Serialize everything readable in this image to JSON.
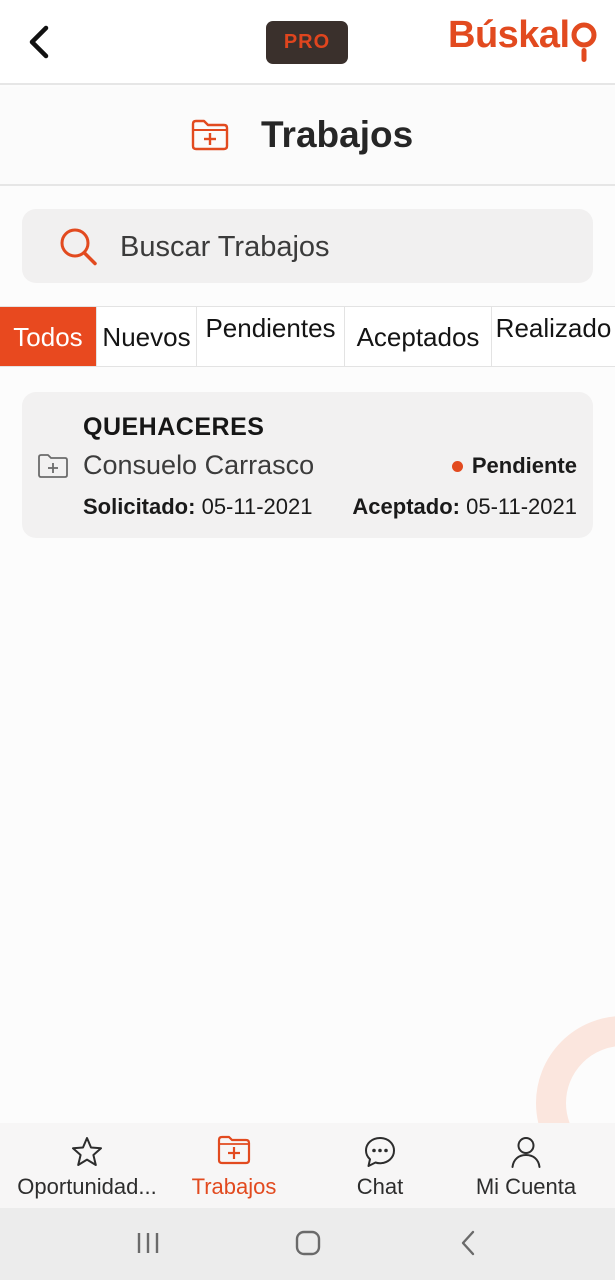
{
  "topbar": {
    "back_icon": "chevron-left-icon",
    "pro_label": "PRO",
    "logo_text": "Búskal",
    "logo_pin_icon": "map-pin-o-icon"
  },
  "header": {
    "icon": "folder-plus-icon",
    "title": "Trabajos"
  },
  "search": {
    "icon": "search-icon",
    "placeholder": "Buscar Trabajos",
    "value": ""
  },
  "tabs": [
    {
      "label": "Todos",
      "active": true
    },
    {
      "label": "Nuevos",
      "active": false
    },
    {
      "label": "Pendientes",
      "active": false
    },
    {
      "label": "Aceptados",
      "active": false
    },
    {
      "label": "Realizado",
      "active": false
    }
  ],
  "jobs": [
    {
      "category": "QUEHACERES",
      "client": "Consuelo Carrasco",
      "status": "Pendiente",
      "requested_label": "Solicitado:",
      "requested_date": "05-11-2021",
      "accepted_label": "Aceptado:",
      "accepted_date": "05-11-2021"
    }
  ],
  "bottom_nav": [
    {
      "label": "Oportunidad...",
      "icon": "star-icon",
      "active": false
    },
    {
      "label": "Trabajos",
      "icon": "folder-plus-icon",
      "active": true
    },
    {
      "label": "Chat",
      "icon": "chat-bubble-icon",
      "active": false
    },
    {
      "label": "Mi Cuenta",
      "icon": "user-icon",
      "active": false
    }
  ],
  "colors": {
    "accent": "#e24a1f",
    "pro_badge_bg": "#3a302c",
    "card_bg": "#f2f1f1"
  }
}
